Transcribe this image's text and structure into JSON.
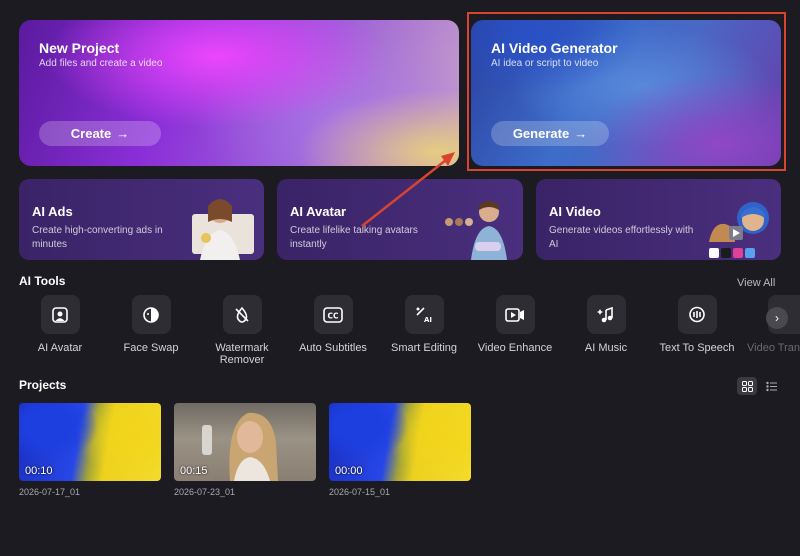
{
  "hero": {
    "new_project": {
      "title": "New Project",
      "subtitle": "Add files and create a video",
      "button": "Create"
    },
    "ai_video_generator": {
      "title": "AI Video Generator",
      "subtitle": "AI idea or script to video",
      "button": "Generate"
    }
  },
  "cards": [
    {
      "title": "AI Ads",
      "description": "Create high-converting ads in minutes"
    },
    {
      "title": "AI Avatar",
      "description": "Create lifelike talking avatars instantly"
    },
    {
      "title": "AI Video",
      "description": "Generate videos effortlessly with AI"
    }
  ],
  "tools_section": {
    "title": "AI Tools",
    "view_all": "View All",
    "items": [
      {
        "label": "AI Avatar",
        "icon": "avatar-icon"
      },
      {
        "label": "Face Swap",
        "icon": "face-swap-icon"
      },
      {
        "label": "Watermark\nRemover",
        "icon": "watermark-remover-icon"
      },
      {
        "label": "Auto Subtitles",
        "icon": "cc-icon"
      },
      {
        "label": "Smart Editing",
        "icon": "ai-edit-icon"
      },
      {
        "label": "Video Enhance",
        "icon": "video-enhance-icon"
      },
      {
        "label": "AI Music",
        "icon": "music-icon"
      },
      {
        "label": "Text To Speech",
        "icon": "speech-icon"
      },
      {
        "label": "Video Trans",
        "icon": "video-translate-icon"
      }
    ]
  },
  "projects_section": {
    "title": "Projects",
    "items": [
      {
        "duration": "00:10",
        "date": "2026-07-17_01"
      },
      {
        "duration": "00:15",
        "date": "2026-07-23_01"
      },
      {
        "duration": "00:00",
        "date": "2026-07-15_01"
      }
    ]
  },
  "colors": {
    "background": "#1c1b21",
    "highlight": "#d9442f",
    "tile": "#2e2d34"
  }
}
